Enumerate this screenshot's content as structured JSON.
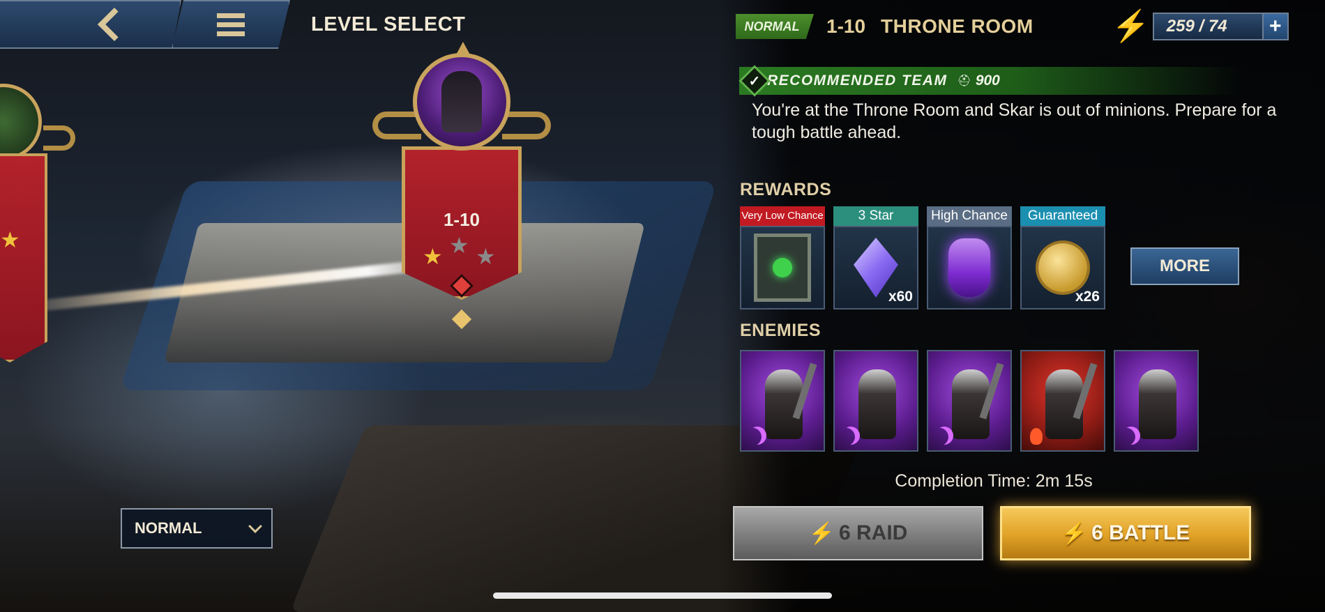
{
  "header": {
    "title": "LEVEL SELECT",
    "back_icon": "chevron-left-icon",
    "menu_icon": "hamburger-menu-icon"
  },
  "map": {
    "current_level": {
      "label": "1-10",
      "stars_earned": 1,
      "stars_total": 3
    },
    "previous_level": {
      "stars_earned_visible": 1
    }
  },
  "difficulty": {
    "selected": "NORMAL"
  },
  "stage": {
    "mode": "NORMAL",
    "number": "1-10",
    "name": "THRONE ROOM"
  },
  "energy": {
    "value": "259 / 74",
    "plus": "+"
  },
  "recommended": {
    "label": "RECOMMENDED TEAM",
    "power": "900",
    "check": "✓"
  },
  "description": "You're at the Throne Room and Skar is out of minions. Prepare for a tough battle ahead.",
  "rewards": {
    "heading": "REWARDS",
    "items": [
      {
        "tag": "Very Low Chance",
        "icon": "gear-chest-icon",
        "qty": ""
      },
      {
        "tag": "3 Star",
        "icon": "crystal-icon",
        "qty": "x60"
      },
      {
        "tag": "High Chance",
        "icon": "potion-icon",
        "qty": ""
      },
      {
        "tag": "Guaranteed",
        "icon": "gold-coins-icon",
        "qty": "x26"
      }
    ],
    "more_label": "MORE"
  },
  "enemies": {
    "heading": "ENEMIES",
    "items": [
      {
        "affinity": "magic",
        "badge_icon": "moon-icon"
      },
      {
        "affinity": "magic",
        "badge_icon": "moon-icon"
      },
      {
        "affinity": "magic",
        "badge_icon": "moon-icon"
      },
      {
        "affinity": "force",
        "badge_icon": "fire-icon"
      },
      {
        "affinity": "magic",
        "badge_icon": "moon-icon"
      }
    ]
  },
  "completion_time": "Completion Time: 2m 15s",
  "actions": {
    "raid_label": "6 RAID",
    "battle_label": "6 BATTLE"
  },
  "colors": {
    "accent_gold": "#e4cf9a",
    "battle_button": "#e0a126",
    "mode_green": "#4c8e2d"
  }
}
